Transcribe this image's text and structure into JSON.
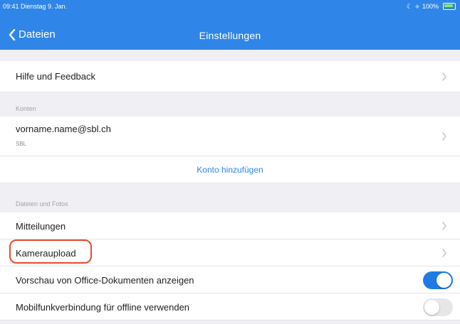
{
  "status_bar": {
    "time_date": "09:41  Dienstag 9. Jan.",
    "battery": "100%"
  },
  "nav": {
    "back_label": "Dateien",
    "title": "Einstellungen"
  },
  "rows": {
    "help_feedback": "Hilfe und Feedback",
    "accounts_header": "Konten",
    "account_email": "vorname.name@sbl.ch",
    "account_org": "SBL",
    "add_account": "Konto hinzufügen",
    "files_photos_header": "Dateien und Fotos",
    "notifications": "Mitteilungen",
    "camera_upload": "Kameraupload",
    "office_preview": "Vorschau von Office-Dokumenten anzeigen",
    "cellular_offline": "Mobilfunkverbindung für offline verwenden"
  },
  "toggles": {
    "office_preview_on": true,
    "cellular_offline_on": false
  },
  "colors": {
    "accent": "#2f86e8",
    "highlight": "#e64b2f"
  }
}
